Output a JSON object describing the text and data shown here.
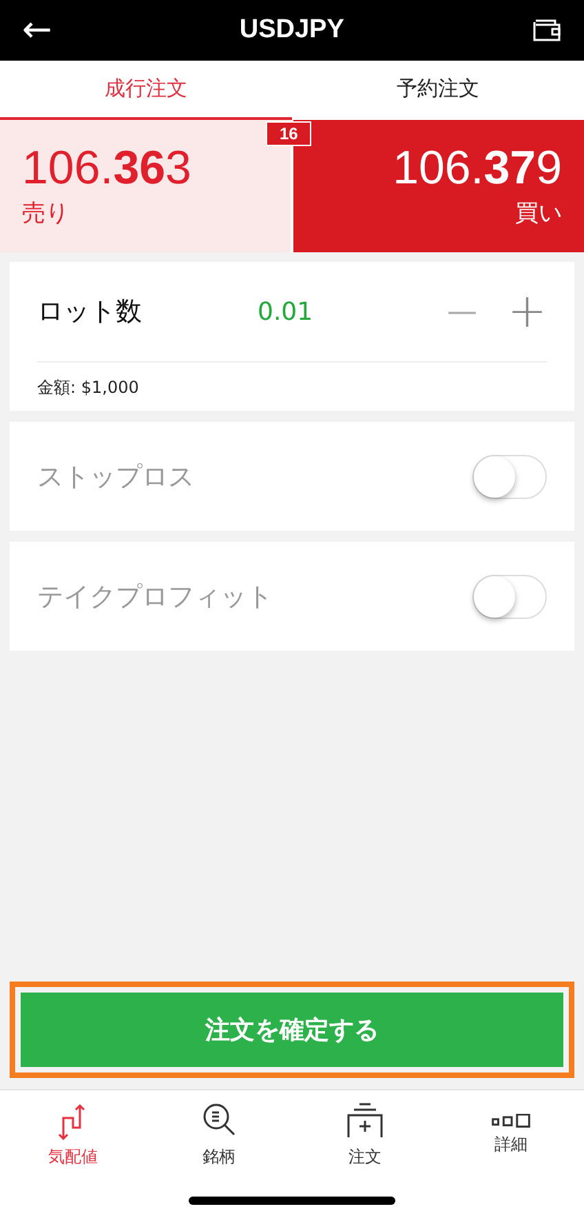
{
  "header": {
    "back": "←",
    "title": "USDJPY"
  },
  "tabs": [
    {
      "label": "成行注文",
      "selected": true
    },
    {
      "label": "予約注文",
      "selected": false
    }
  ],
  "quote": {
    "sell": {
      "price": "106.**36**3",
      "label": "売り"
    },
    "spread": "16",
    "buy": {
      "price": "106.**37**9",
      "label": "買い"
    }
  },
  "lot": {
    "label": "ロット数",
    "value": "0.01",
    "minus": "—",
    "plus": "+",
    "amount": "金額: $1,000"
  },
  "options": [
    {
      "label": "ストップロス",
      "on": false
    },
    {
      "label": "テイクプロフィット",
      "on": false
    }
  ],
  "confirm": {
    "label": "注文を確定する",
    "highlighted": true
  },
  "nav": [
    {
      "kind": "quotes",
      "label": "気配値",
      "selected": true
    },
    {
      "kind": "symbols",
      "label": "銘柄",
      "selected": false
    },
    {
      "kind": "order",
      "label": "注文",
      "selected": false
    },
    {
      "kind": "details",
      "label": "詳細",
      "selected": false
    }
  ]
}
